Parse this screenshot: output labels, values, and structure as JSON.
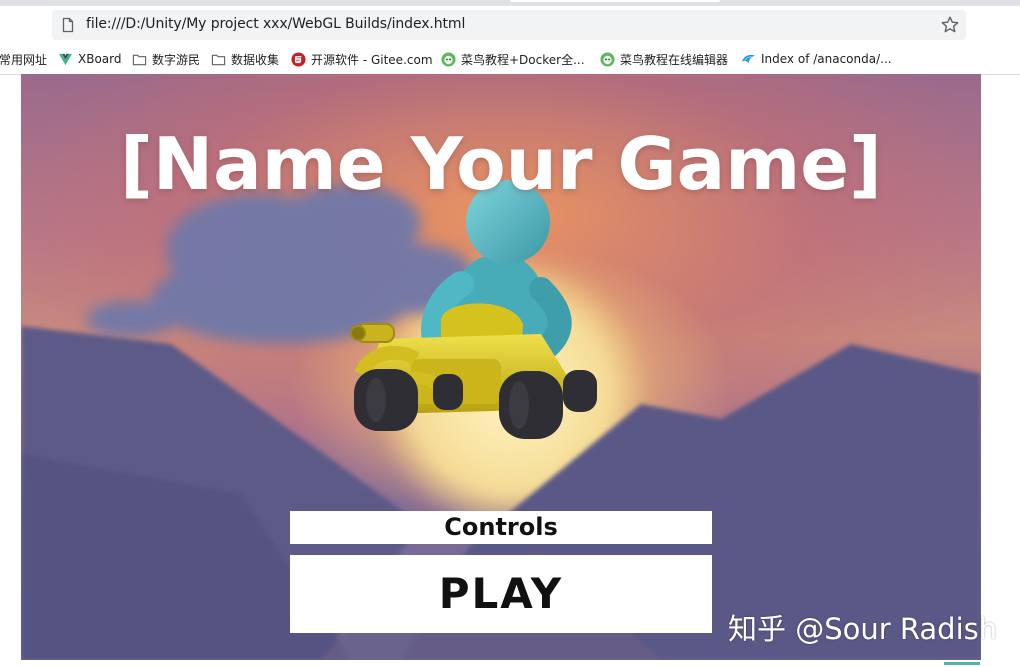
{
  "browser": {
    "url": "file:///D:/Unity/My project xxx/WebGL Builds/index.html",
    "bookmarks": [
      {
        "label": "常用网址",
        "icon": "none"
      },
      {
        "label": "XBoard",
        "icon": "vue-logo-icon"
      },
      {
        "label": "数字游民",
        "icon": "folder-icon"
      },
      {
        "label": "数据收集",
        "icon": "folder-icon"
      },
      {
        "label": "开源软件 - Gitee.com",
        "icon": "gitee-logo-icon"
      },
      {
        "label": "菜鸟教程+Docker全...",
        "icon": "runoob-logo-icon"
      },
      {
        "label": "菜鸟教程在线编辑器",
        "icon": "runoob-logo-icon"
      },
      {
        "label": "Index of /anaconda/...",
        "icon": "anaconda-bird-icon"
      }
    ]
  },
  "game": {
    "title": "[Name Your Game]",
    "controls_label": "Controls",
    "play_label": "PLAY"
  },
  "watermark": "知乎 @Sour Radish",
  "colors": {
    "button_bg": "#ffffff",
    "button_text": "#111111",
    "title_text": "#ffffff",
    "character": "#4fb8c4",
    "kart": "#d6c21f"
  }
}
